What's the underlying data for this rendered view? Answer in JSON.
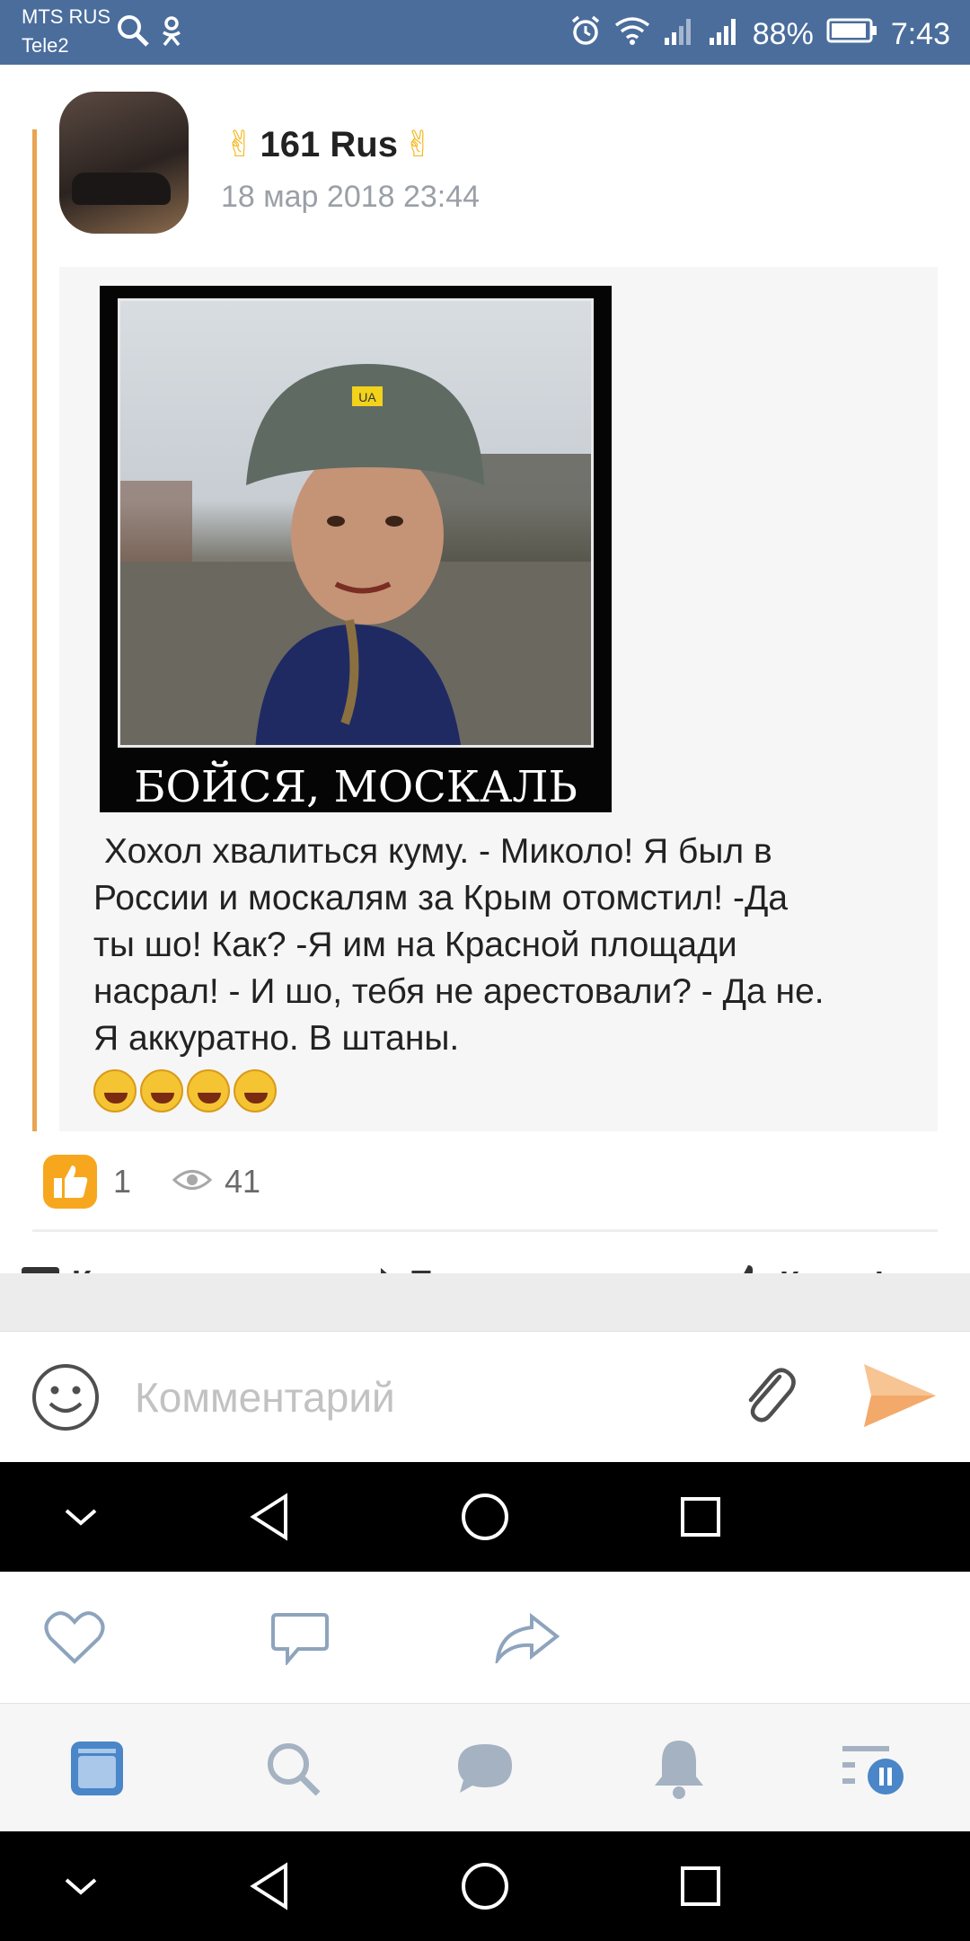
{
  "status_bar": {
    "carrier1": "MTS RUS",
    "carrier2": "Tele2",
    "battery": "88%",
    "time": "7:43"
  },
  "post": {
    "author": "161 Rus",
    "date": "18 мар 2018 23:44",
    "meme_caption": "БОЙСЯ, МОСКАЛЬ",
    "helmet_label": "UA",
    "text_lines": [
      "Хохол хвалиться куму. - Миколо! Я был в",
      "России и москалям за Крым отомстил! -Да",
      "ты шо! Как? -Я им на Красной площади",
      "насрал! - И шо, тебя не арестовали? - Да не.",
      "Я аккуратно. В штаны."
    ],
    "emoji_count": 4,
    "likes": "1",
    "views": "41"
  },
  "actions": {
    "comments": "Комментарии",
    "share": "Поделиться",
    "class": "Класс!"
  },
  "comment_box": {
    "placeholder": "Комментарий"
  },
  "colors": {
    "status_bar": "#4a6d9c",
    "accent_orange": "#f7a71d",
    "repost_bar": "#e8a553",
    "tab_active": "#4a86c8"
  }
}
